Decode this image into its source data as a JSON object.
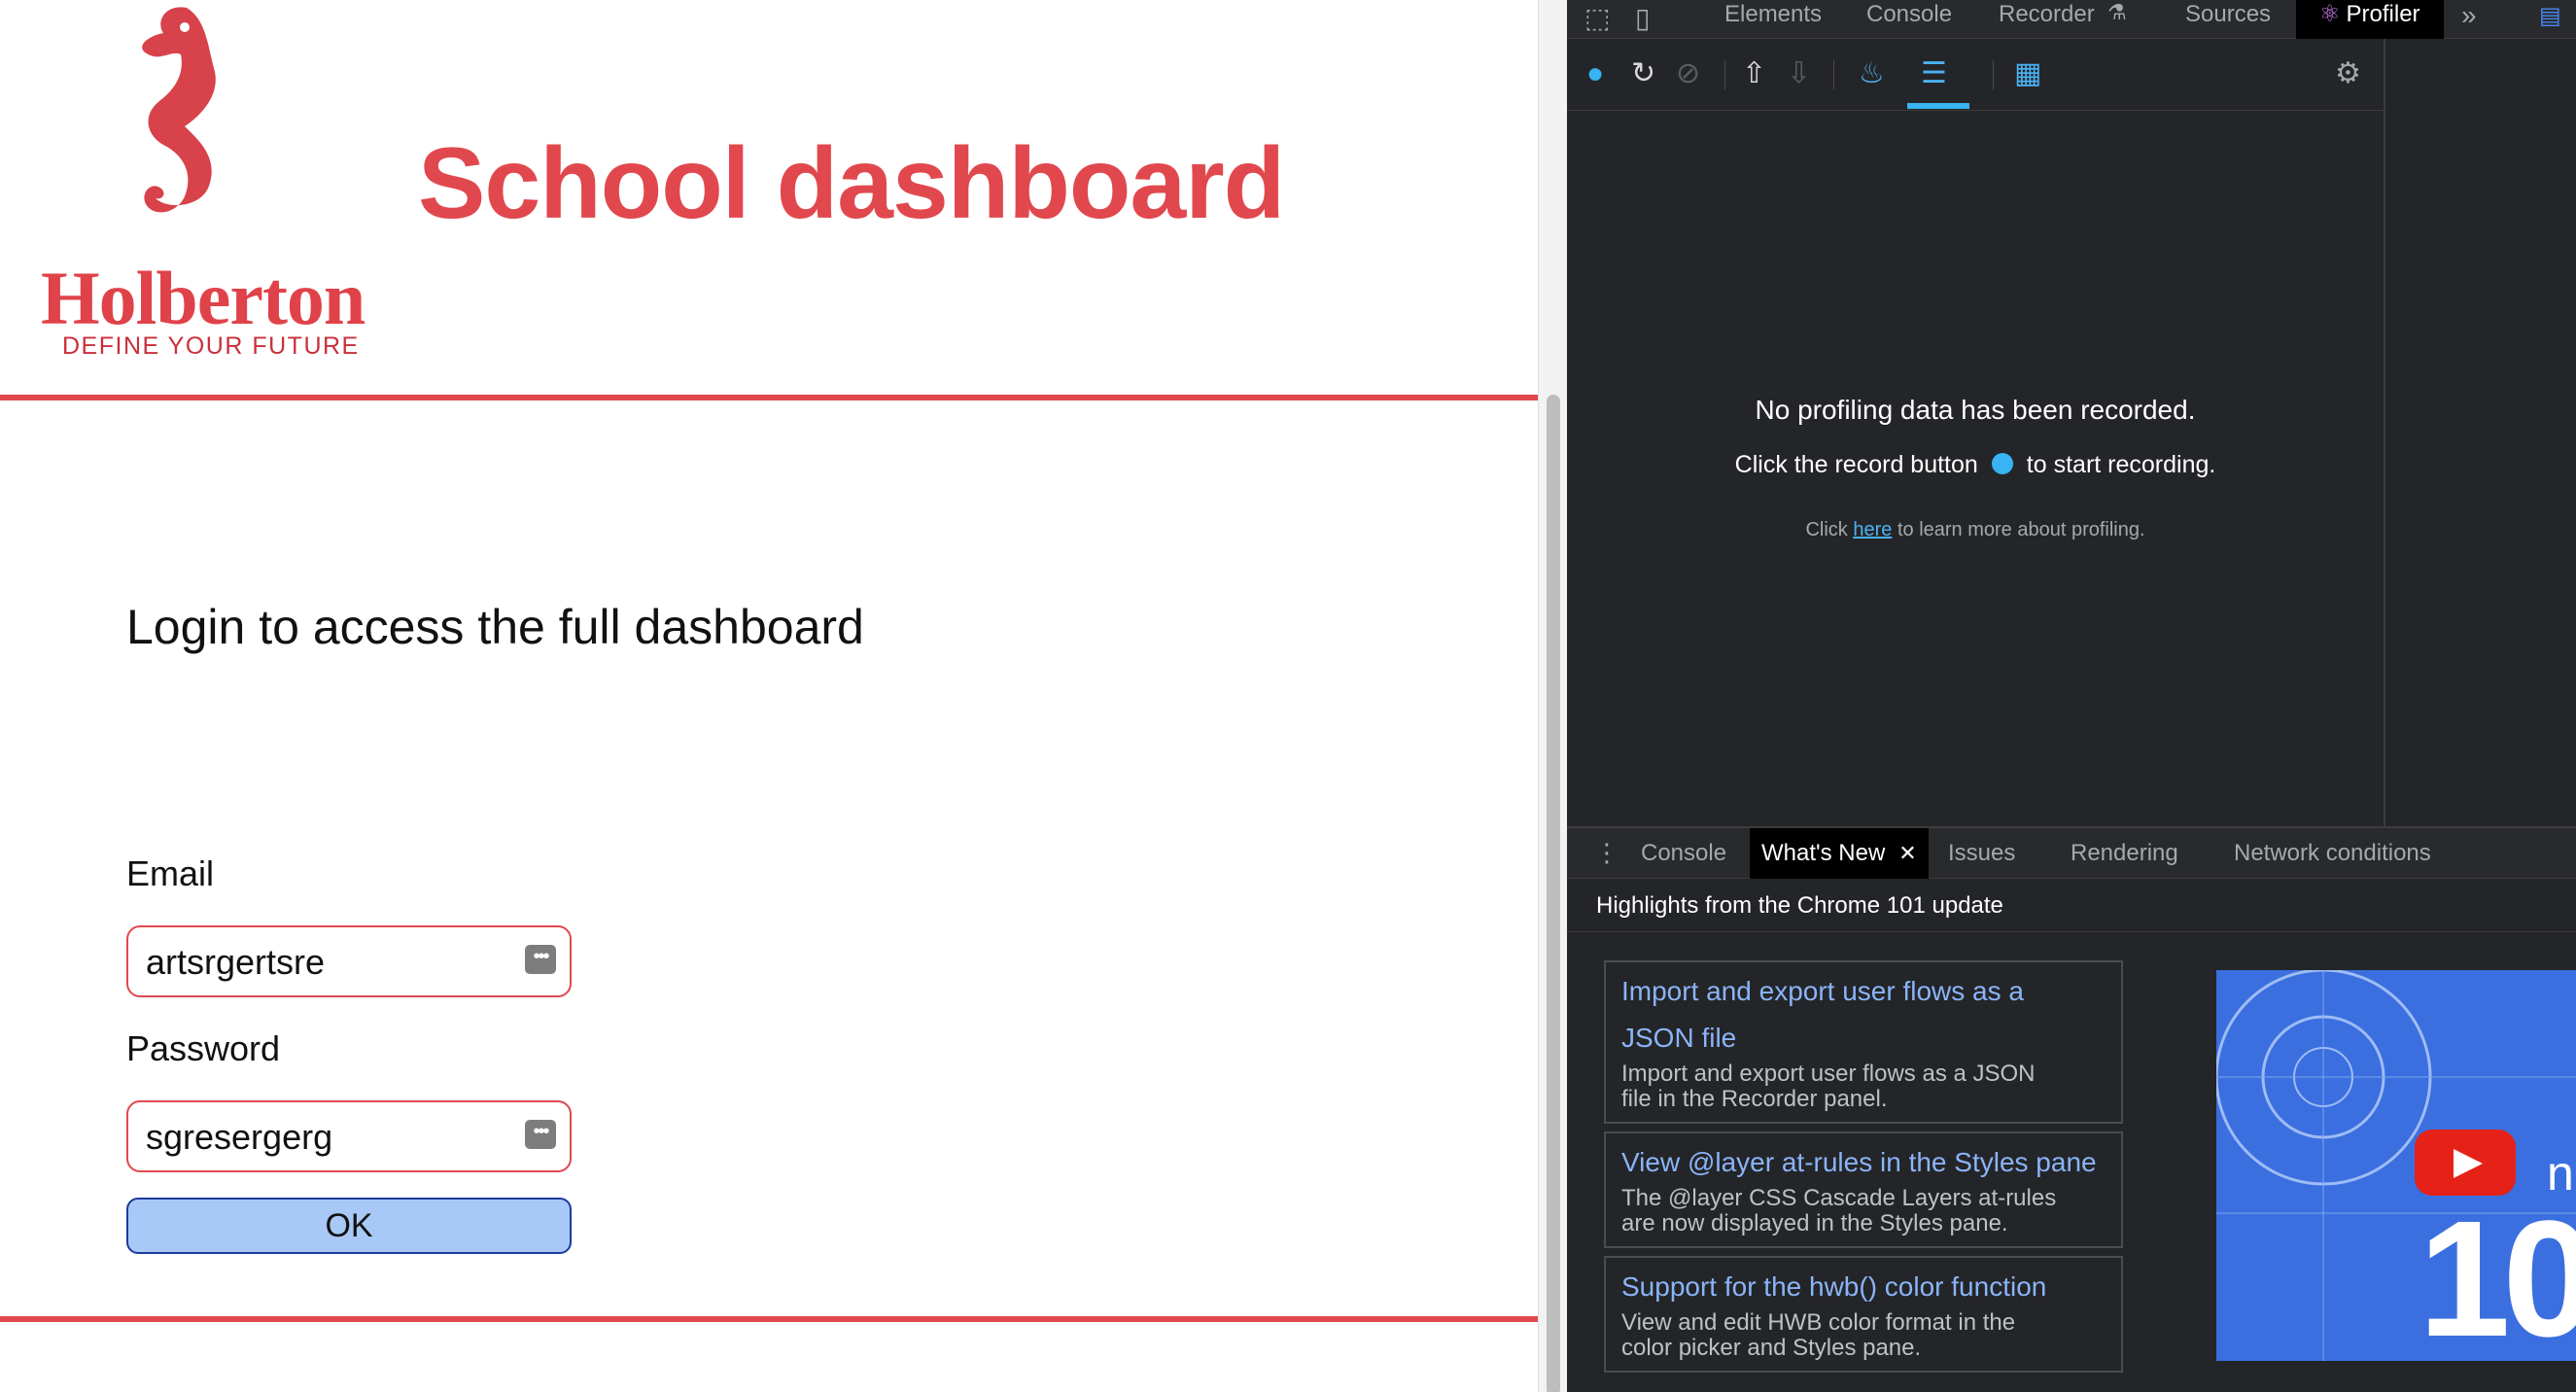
{
  "page": {
    "logo": {
      "wordmark": "Holberton",
      "tagline": "DEFINE YOUR FUTURE"
    },
    "title": "School dashboard",
    "login_heading": "Login to access the full dashboard",
    "email": {
      "label": "Email",
      "value": "artsrgertsre"
    },
    "password": {
      "label": "Password",
      "value": "sgresergerg"
    },
    "ok_label": "OK",
    "colors": {
      "brand": "#e1484e",
      "button": "#a8c8f7"
    }
  },
  "devtools": {
    "tabs": [
      "Elements",
      "Console",
      "Recorder",
      "Sources",
      "Profiler"
    ],
    "active_tab": "Profiler",
    "toolbar_icons": [
      "record-icon",
      "reload-icon",
      "clear-icon",
      "upload-icon",
      "download-icon",
      "flamegraph-icon",
      "ranked-icon",
      "timeline-icon",
      "settings-icon"
    ],
    "empty_state": {
      "title": "No profiling data has been recorded.",
      "sub_before": "Click the record button",
      "sub_after": "to start recording.",
      "hint_before": "Click",
      "hint_link": "here",
      "hint_after": "to learn more about profiling."
    },
    "drawer": {
      "tabs": [
        "Console",
        "What's New",
        "Issues",
        "Rendering",
        "Network conditions"
      ],
      "active_tab": "What's New",
      "heading": "Highlights from the Chrome 101 update",
      "cards": [
        {
          "title_line1": "Import and export user flows as a",
          "title_line2": "JSON file",
          "desc_line1": "Import and export user flows as a JSON",
          "desc_line2": "file in the Recorder panel."
        },
        {
          "title_line1": "View @layer at-rules in the Styles pane",
          "desc_line1": "The @layer CSS Cascade Layers at-rules",
          "desc_line2": "are now displayed in the Styles pane."
        },
        {
          "title_line1": "Support for the hwb() color function",
          "desc_line1": "View and edit HWB color format in the",
          "desc_line2": "color picker and Styles pane."
        }
      ],
      "video_text": "10",
      "video_letter": "n"
    }
  }
}
